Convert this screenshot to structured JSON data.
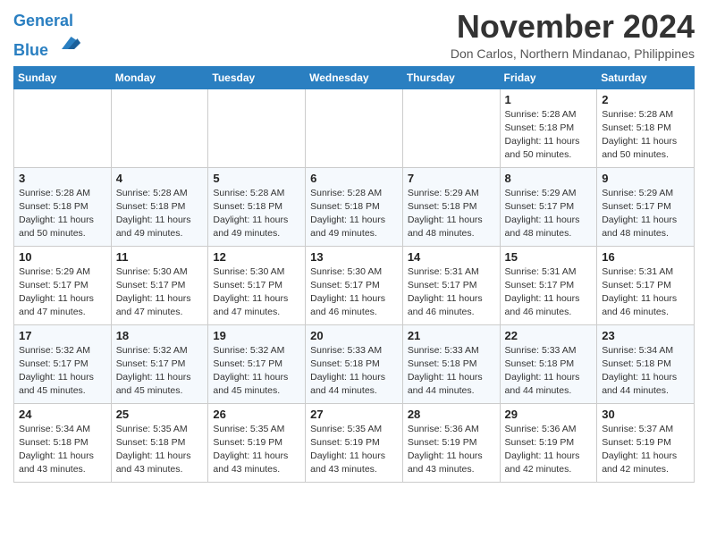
{
  "header": {
    "logo_line1": "General",
    "logo_line2": "Blue",
    "month": "November 2024",
    "location": "Don Carlos, Northern Mindanao, Philippines"
  },
  "weekdays": [
    "Sunday",
    "Monday",
    "Tuesday",
    "Wednesday",
    "Thursday",
    "Friday",
    "Saturday"
  ],
  "weeks": [
    [
      {
        "day": "",
        "info": ""
      },
      {
        "day": "",
        "info": ""
      },
      {
        "day": "",
        "info": ""
      },
      {
        "day": "",
        "info": ""
      },
      {
        "day": "",
        "info": ""
      },
      {
        "day": "1",
        "info": "Sunrise: 5:28 AM\nSunset: 5:18 PM\nDaylight: 11 hours\nand 50 minutes."
      },
      {
        "day": "2",
        "info": "Sunrise: 5:28 AM\nSunset: 5:18 PM\nDaylight: 11 hours\nand 50 minutes."
      }
    ],
    [
      {
        "day": "3",
        "info": "Sunrise: 5:28 AM\nSunset: 5:18 PM\nDaylight: 11 hours\nand 50 minutes."
      },
      {
        "day": "4",
        "info": "Sunrise: 5:28 AM\nSunset: 5:18 PM\nDaylight: 11 hours\nand 49 minutes."
      },
      {
        "day": "5",
        "info": "Sunrise: 5:28 AM\nSunset: 5:18 PM\nDaylight: 11 hours\nand 49 minutes."
      },
      {
        "day": "6",
        "info": "Sunrise: 5:28 AM\nSunset: 5:18 PM\nDaylight: 11 hours\nand 49 minutes."
      },
      {
        "day": "7",
        "info": "Sunrise: 5:29 AM\nSunset: 5:18 PM\nDaylight: 11 hours\nand 48 minutes."
      },
      {
        "day": "8",
        "info": "Sunrise: 5:29 AM\nSunset: 5:17 PM\nDaylight: 11 hours\nand 48 minutes."
      },
      {
        "day": "9",
        "info": "Sunrise: 5:29 AM\nSunset: 5:17 PM\nDaylight: 11 hours\nand 48 minutes."
      }
    ],
    [
      {
        "day": "10",
        "info": "Sunrise: 5:29 AM\nSunset: 5:17 PM\nDaylight: 11 hours\nand 47 minutes."
      },
      {
        "day": "11",
        "info": "Sunrise: 5:30 AM\nSunset: 5:17 PM\nDaylight: 11 hours\nand 47 minutes."
      },
      {
        "day": "12",
        "info": "Sunrise: 5:30 AM\nSunset: 5:17 PM\nDaylight: 11 hours\nand 47 minutes."
      },
      {
        "day": "13",
        "info": "Sunrise: 5:30 AM\nSunset: 5:17 PM\nDaylight: 11 hours\nand 46 minutes."
      },
      {
        "day": "14",
        "info": "Sunrise: 5:31 AM\nSunset: 5:17 PM\nDaylight: 11 hours\nand 46 minutes."
      },
      {
        "day": "15",
        "info": "Sunrise: 5:31 AM\nSunset: 5:17 PM\nDaylight: 11 hours\nand 46 minutes."
      },
      {
        "day": "16",
        "info": "Sunrise: 5:31 AM\nSunset: 5:17 PM\nDaylight: 11 hours\nand 46 minutes."
      }
    ],
    [
      {
        "day": "17",
        "info": "Sunrise: 5:32 AM\nSunset: 5:17 PM\nDaylight: 11 hours\nand 45 minutes."
      },
      {
        "day": "18",
        "info": "Sunrise: 5:32 AM\nSunset: 5:17 PM\nDaylight: 11 hours\nand 45 minutes."
      },
      {
        "day": "19",
        "info": "Sunrise: 5:32 AM\nSunset: 5:17 PM\nDaylight: 11 hours\nand 45 minutes."
      },
      {
        "day": "20",
        "info": "Sunrise: 5:33 AM\nSunset: 5:18 PM\nDaylight: 11 hours\nand 44 minutes."
      },
      {
        "day": "21",
        "info": "Sunrise: 5:33 AM\nSunset: 5:18 PM\nDaylight: 11 hours\nand 44 minutes."
      },
      {
        "day": "22",
        "info": "Sunrise: 5:33 AM\nSunset: 5:18 PM\nDaylight: 11 hours\nand 44 minutes."
      },
      {
        "day": "23",
        "info": "Sunrise: 5:34 AM\nSunset: 5:18 PM\nDaylight: 11 hours\nand 44 minutes."
      }
    ],
    [
      {
        "day": "24",
        "info": "Sunrise: 5:34 AM\nSunset: 5:18 PM\nDaylight: 11 hours\nand 43 minutes."
      },
      {
        "day": "25",
        "info": "Sunrise: 5:35 AM\nSunset: 5:18 PM\nDaylight: 11 hours\nand 43 minutes."
      },
      {
        "day": "26",
        "info": "Sunrise: 5:35 AM\nSunset: 5:19 PM\nDaylight: 11 hours\nand 43 minutes."
      },
      {
        "day": "27",
        "info": "Sunrise: 5:35 AM\nSunset: 5:19 PM\nDaylight: 11 hours\nand 43 minutes."
      },
      {
        "day": "28",
        "info": "Sunrise: 5:36 AM\nSunset: 5:19 PM\nDaylight: 11 hours\nand 43 minutes."
      },
      {
        "day": "29",
        "info": "Sunrise: 5:36 AM\nSunset: 5:19 PM\nDaylight: 11 hours\nand 42 minutes."
      },
      {
        "day": "30",
        "info": "Sunrise: 5:37 AM\nSunset: 5:19 PM\nDaylight: 11 hours\nand 42 minutes."
      }
    ]
  ]
}
